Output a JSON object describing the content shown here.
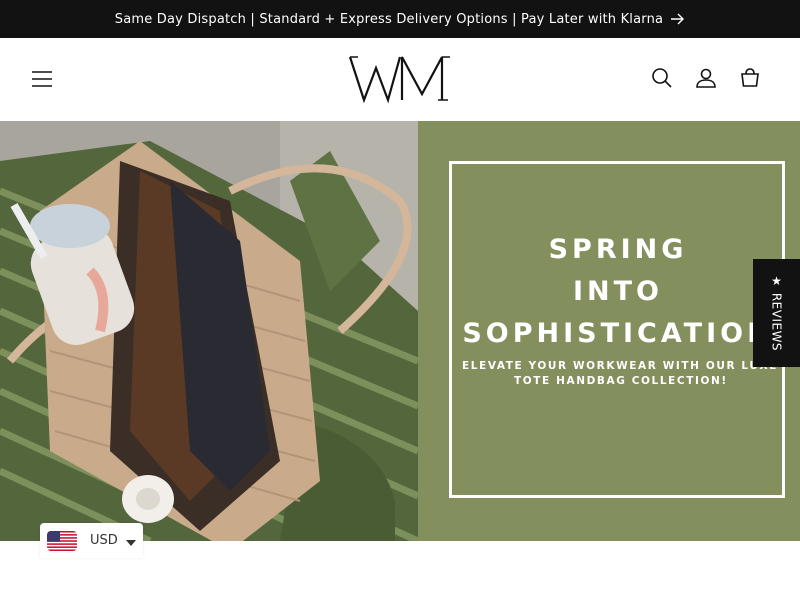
{
  "announcement": {
    "text": "Same Day Dispatch | Standard + Express Delivery Options | Pay Later with Klarna",
    "arrow_icon": "arrow-right-icon"
  },
  "header": {
    "menu_icon": "hamburger-menu-icon",
    "logo_text": "WM",
    "icons": [
      "search-icon",
      "account-icon",
      "cart-icon"
    ]
  },
  "hero": {
    "heading_lines": [
      "SPRING",
      "INTO",
      "SOPHISTICATION"
    ],
    "subheading_lines": [
      "ELEVATE YOUR WORKWEAR WITH OUR LUXE",
      "TOTE HANDBAG COLLECTION!"
    ],
    "panel_color": "#838f5d",
    "photo_description_icon": "tote-bag-photo"
  },
  "reviews_tab": {
    "label": "★ REVIEWS"
  },
  "currency_selector": {
    "value": "USD",
    "flag_icon": "us-flag-icon",
    "caret_icon": "caret-down-icon"
  },
  "colors": {
    "announcement_bg": "#121212",
    "panel_green": "#838f5d",
    "text_white": "#ffffff"
  }
}
